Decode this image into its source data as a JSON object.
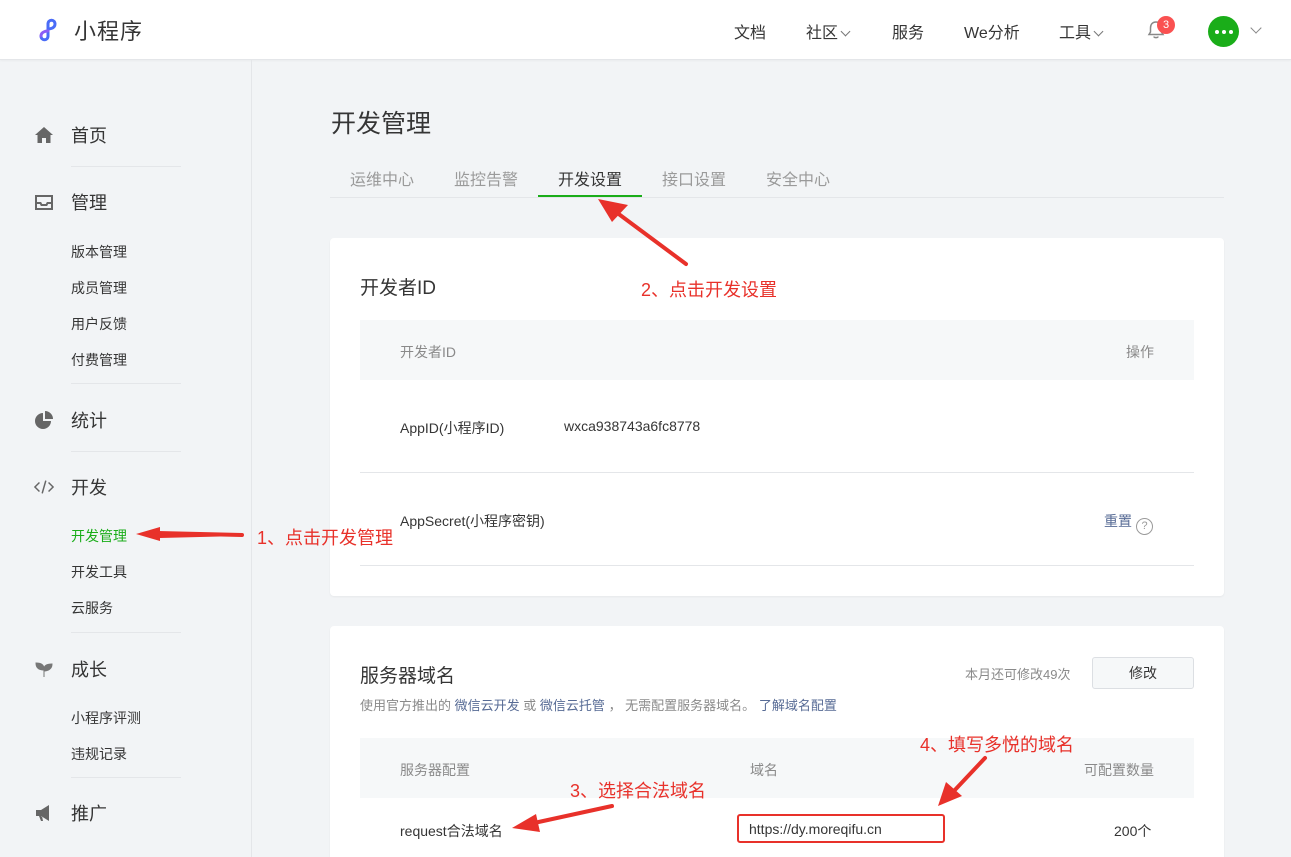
{
  "header": {
    "logo_text": "小程序",
    "nav": [
      {
        "label": "文档"
      },
      {
        "label": "社区"
      },
      {
        "label": "服务"
      },
      {
        "label": "We分析"
      },
      {
        "label": "工具"
      }
    ],
    "notification_count": "3"
  },
  "sidebar": {
    "sections": [
      {
        "label": "首页",
        "icon": "home-icon"
      },
      {
        "label": "管理",
        "icon": "inbox-icon",
        "items": [
          "版本管理",
          "成员管理",
          "用户反馈",
          "付费管理"
        ]
      },
      {
        "label": "统计",
        "icon": "pie-chart-icon"
      },
      {
        "label": "开发",
        "icon": "code-icon",
        "items": [
          "开发管理",
          "开发工具",
          "云服务"
        ]
      },
      {
        "label": "成长",
        "icon": "sprout-icon",
        "items": [
          "小程序评测",
          "违规记录"
        ]
      },
      {
        "label": "推广",
        "icon": "megaphone-icon"
      }
    ]
  },
  "main": {
    "title": "开发管理",
    "tabs": [
      "运维中心",
      "监控告警",
      "开发设置",
      "接口设置",
      "安全中心"
    ],
    "active_tab": "开发设置",
    "developer_id": {
      "title": "开发者ID",
      "columns": [
        "开发者ID",
        "操作"
      ],
      "rows": [
        {
          "label": "AppID(小程序ID)",
          "value": "wxca938743a6fc8778"
        },
        {
          "label": "AppSecret(小程序密钥)",
          "action": "重置",
          "help": "?"
        }
      ]
    },
    "server_domain": {
      "title": "服务器域名",
      "remaining_text": "本月还可修改49次",
      "modify_button": "修改",
      "desc_prefix": "使用官方推出的",
      "link_cloud_dev": "微信云开发",
      "desc_or": "或",
      "link_cloud_host": "微信云托管",
      "desc_suffix": "， 无需配置服务器域名。",
      "link_learn": "了解域名配置",
      "columns": [
        "服务器配置",
        "域名",
        "可配置数量"
      ],
      "rows": [
        {
          "config": "request合法域名",
          "domain": "https://dy.moreqifu.cn",
          "count": "200个"
        }
      ]
    }
  },
  "annotations": {
    "step1": "1、点击开发管理",
    "step2": "2、点击开发设置",
    "step3": "3、选择合法域名",
    "step4": "4、填写多悦的域名",
    "color": "#e8312a"
  },
  "colors": {
    "brand_green": "#1aad19",
    "link_blue": "#576b95",
    "badge_red": "#fa5151"
  }
}
